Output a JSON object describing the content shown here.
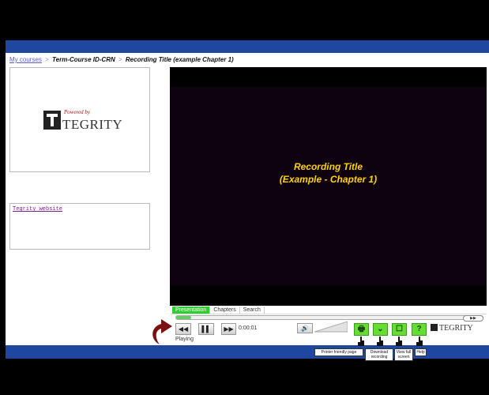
{
  "breadcrumb": {
    "my_courses": "My courses",
    "sep1": ">",
    "course": "Term-Course ID-CRN",
    "sep2": ">",
    "recording": "Recording Title (example Chapter 1)"
  },
  "logo": {
    "powered_by": "Powered by",
    "wordmark": "TEGRITY"
  },
  "links": {
    "tegrity_website": "Tegrity website"
  },
  "video": {
    "title_line1": "Recording Title",
    "title_line2": "(Example - Chapter 1)"
  },
  "tabs": [
    "Presentation",
    "Chapters",
    "Search"
  ],
  "progress": {
    "fraction": 0.05
  },
  "controls": {
    "rewind": "◀◀",
    "pause": "▌▌",
    "fast_forward": "▶▶",
    "time": "0:00:01",
    "speed": "▶▶",
    "volume_icon": "🔊",
    "status": "Playing"
  },
  "actions": {
    "print_symbol": "🖶",
    "download_symbol": "⌄",
    "fullscreen_symbol": "☐",
    "help_symbol": "?"
  },
  "brand_small": "TEGRITY",
  "tooltips": {
    "print": "Printer friendly page",
    "download": "Download recording",
    "full_screen": "View full screen",
    "help": "Help"
  },
  "colors": {
    "blue_bar": "#1f47a0",
    "title_yellow": "#ffd200",
    "accent_green": "#66dd33",
    "arrow_red": "#7a1010"
  }
}
